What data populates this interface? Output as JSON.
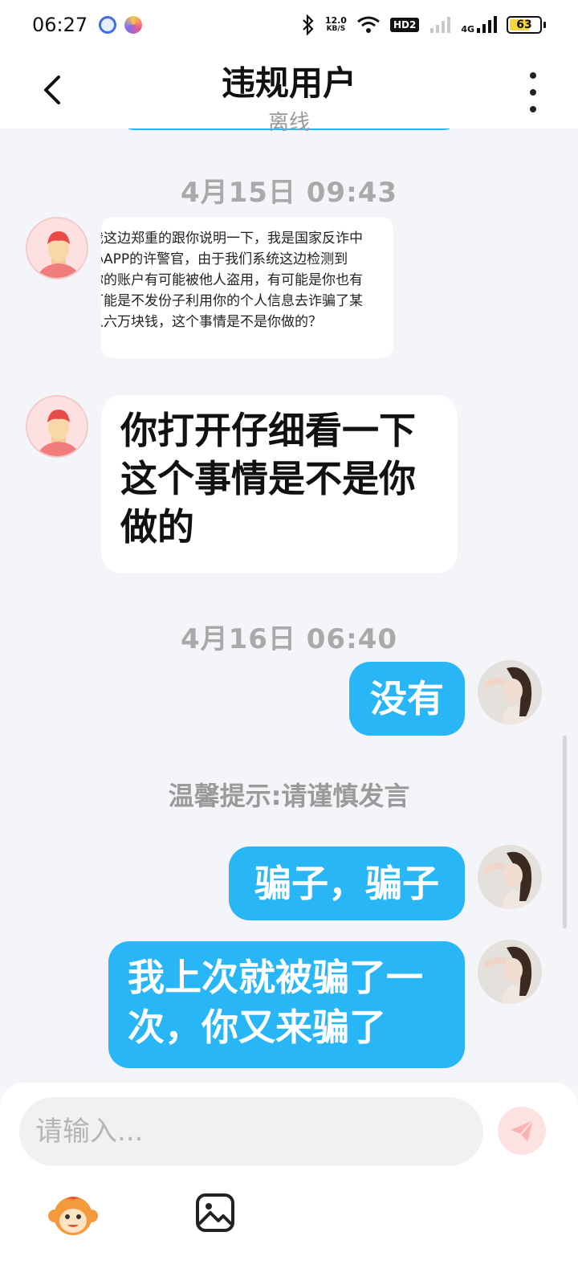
{
  "status_bar": {
    "time": "06:27",
    "speed_value": "12.0",
    "speed_unit": "KB/S",
    "hd_label": "HD2",
    "network_label": "4G",
    "battery": "63"
  },
  "header": {
    "title": "违规用户",
    "subtitle": "离线"
  },
  "messages": {
    "divider_1": "4月15日 09:43",
    "image_lines": [
      "我这边郑重的跟你说明一下，我是国家反诈中",
      "心APP的许警官，由于我们系统这边检测到",
      "你的账户有可能被他人盗用，有可能是你也有",
      "可能是不发份子利用你的个人信息去诈骗了某",
      "人六万块钱，这个事情是不是你做的？"
    ],
    "msg_2": "你打开仔细看一下这个事情是不是你做的",
    "divider_2": "4月16日 06:40",
    "msg_3": "没有",
    "tip": "温馨提示:请谨慎发言",
    "msg_4": "骗子，骗子",
    "msg_5": "我上次就被骗了一次，你又来骗了"
  },
  "input": {
    "placeholder": "请输入..."
  },
  "colors": {
    "accent": "#29b6f6",
    "background": "#f3f5f8",
    "send_button": "#fde2e2"
  },
  "icons": [
    "back-arrow-icon",
    "more-vertical-icon",
    "send-icon",
    "emoji-monkey-icon",
    "image-icon"
  ]
}
